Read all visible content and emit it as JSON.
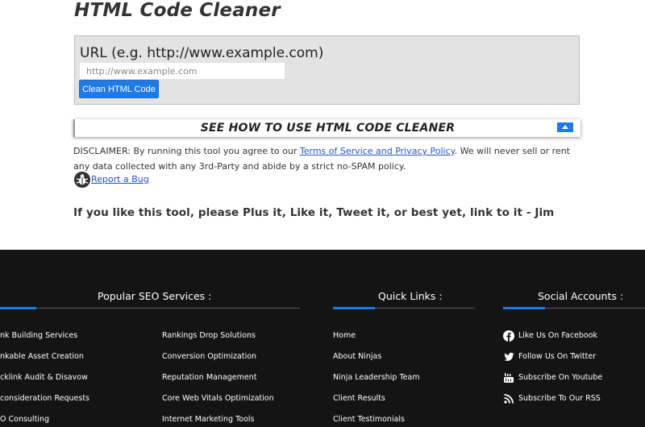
{
  "page": {
    "title": "HTML Code Cleaner"
  },
  "tool": {
    "url_label": "URL (e.g. http://www.example.com)",
    "url_placeholder": "http://www.example.com",
    "url_value": "",
    "clean_button": "Clean HTML Code"
  },
  "howto": {
    "heading": "SEE HOW TO USE HTML CODE CLEANER"
  },
  "disclaimer": {
    "prefix": "DISCLAIMER: By running this tool you agree to our ",
    "link": "Terms of Service and Privacy Policy",
    "suffix": ". We will never sell or rent any data collected with any 3rd-Party and abide by a strict no-SPAM policy."
  },
  "report": {
    "label": "Report a Bug"
  },
  "plus_line": "If you like this tool, please Plus it, Like it, Tweet it, or best yet, link to it - Jim",
  "footer": {
    "colors": {
      "background": "#141414",
      "accent": "#1f7ae8",
      "text": "#ffffff"
    },
    "popular": {
      "heading": "Popular SEO Services :",
      "col1": [
        "nk Building Services",
        "nkable Asset Creation",
        "cklink Audit & Disavow",
        "consideration Requests",
        "O Consulting"
      ],
      "col2": [
        "Rankings Drop Solutions",
        "Conversion Optimization",
        "Reputation Management",
        "Core Web Vitals Optimization",
        "Internet Marketing Tools"
      ]
    },
    "quick": {
      "heading": "Quick Links :",
      "items": [
        "Home",
        "About Ninjas",
        "Ninja Leadership Team",
        "Client Results",
        "Client Testimonials"
      ]
    },
    "social": {
      "heading": "Social Accounts :",
      "items": [
        {
          "icon": "facebook-icon",
          "label": "Like Us On Facebook"
        },
        {
          "icon": "twitter-icon",
          "label": "Follow Us On Twitter"
        },
        {
          "icon": "youtube-icon",
          "label": "Subscribe On Youtube"
        },
        {
          "icon": "rss-icon",
          "label": "Subscribe To Our RSS"
        }
      ]
    }
  }
}
